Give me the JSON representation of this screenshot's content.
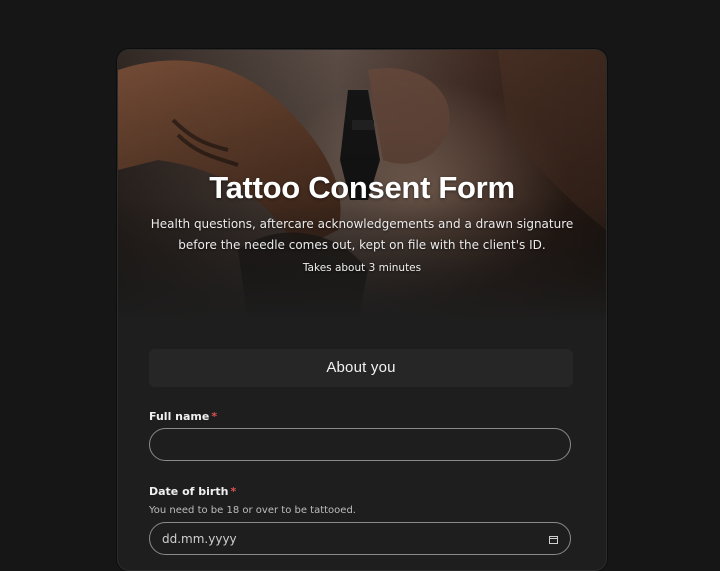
{
  "hero": {
    "title": "Tattoo Consent Form",
    "description": "Health questions, aftercare acknowledgements and a drawn signature before the needle comes out, kept on file with the client's ID.",
    "duration": "Takes about 3 minutes"
  },
  "section": {
    "title": "About you"
  },
  "fields": {
    "full_name": {
      "label": "Full name",
      "required_mark": "*",
      "value": ""
    },
    "dob": {
      "label": "Date of birth",
      "required_mark": "*",
      "help": "You need to be 18 or over to be tattooed.",
      "placeholder": "dd.mm.yyyy"
    }
  },
  "icons": {
    "calendar": "calendar-icon"
  },
  "colors": {
    "page_bg": "#161616",
    "card_bg": "#1e1e1e",
    "required": "#d9534f",
    "input_border": "#8a8a8a"
  }
}
